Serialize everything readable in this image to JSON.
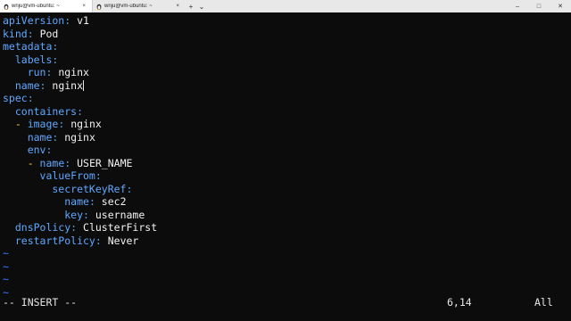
{
  "tabs": [
    {
      "label": "wriju@vm-ubuntu: ~",
      "close": "×"
    },
    {
      "label": "wriju@vm-ubuntu: ~",
      "close": "×"
    }
  ],
  "toolbar": {
    "new_tab": "+",
    "dropdown": "⌄"
  },
  "window": {
    "minimize": "–",
    "maximize": "□",
    "close": "✕"
  },
  "editor": {
    "lines": [
      [
        {
          "t": "apiVersion",
          "c": "k"
        },
        {
          "t": ": ",
          "c": "p"
        },
        {
          "t": "v1",
          "c": "v"
        }
      ],
      [
        {
          "t": "kind",
          "c": "k"
        },
        {
          "t": ": ",
          "c": "p"
        },
        {
          "t": "Pod",
          "c": "v"
        }
      ],
      [
        {
          "t": "metadata",
          "c": "k"
        },
        {
          "t": ":",
          "c": "p"
        }
      ],
      [
        {
          "t": "  labels",
          "c": "k"
        },
        {
          "t": ":",
          "c": "p"
        }
      ],
      [
        {
          "t": "    run",
          "c": "k"
        },
        {
          "t": ": ",
          "c": "p"
        },
        {
          "t": "nginx",
          "c": "v"
        }
      ],
      [
        {
          "t": "  name",
          "c": "k"
        },
        {
          "t": ": ",
          "c": "p"
        },
        {
          "t": "nginx",
          "c": "v"
        }
      ],
      [
        {
          "t": "spec",
          "c": "k"
        },
        {
          "t": ":",
          "c": "p"
        }
      ],
      [
        {
          "t": "  containers",
          "c": "k"
        },
        {
          "t": ":",
          "c": "p"
        }
      ],
      [
        {
          "t": "  - ",
          "c": "d"
        },
        {
          "t": "image",
          "c": "k"
        },
        {
          "t": ": ",
          "c": "p"
        },
        {
          "t": "nginx",
          "c": "v"
        }
      ],
      [
        {
          "t": "    name",
          "c": "k"
        },
        {
          "t": ": ",
          "c": "p"
        },
        {
          "t": "nginx",
          "c": "v"
        }
      ],
      [
        {
          "t": "    env",
          "c": "k"
        },
        {
          "t": ":",
          "c": "p"
        }
      ],
      [
        {
          "t": "    - ",
          "c": "d"
        },
        {
          "t": "name",
          "c": "k"
        },
        {
          "t": ": ",
          "c": "p"
        },
        {
          "t": "USER_NAME",
          "c": "v"
        }
      ],
      [
        {
          "t": "      valueFrom",
          "c": "k"
        },
        {
          "t": ":",
          "c": "p"
        }
      ],
      [
        {
          "t": "        secretKeyRef",
          "c": "k"
        },
        {
          "t": ":",
          "c": "p"
        }
      ],
      [
        {
          "t": "          name",
          "c": "k"
        },
        {
          "t": ": ",
          "c": "p"
        },
        {
          "t": "sec2",
          "c": "v"
        }
      ],
      [
        {
          "t": "          key",
          "c": "k"
        },
        {
          "t": ": ",
          "c": "p"
        },
        {
          "t": "username",
          "c": "v"
        }
      ],
      [
        {
          "t": "  dnsPolicy",
          "c": "k"
        },
        {
          "t": ": ",
          "c": "p"
        },
        {
          "t": "ClusterFirst",
          "c": "v"
        }
      ],
      [
        {
          "t": "  restartPolicy",
          "c": "k"
        },
        {
          "t": ": ",
          "c": "p"
        },
        {
          "t": "Never",
          "c": "v"
        }
      ],
      [
        {
          "t": "~",
          "c": "tilde"
        }
      ],
      [
        {
          "t": "~",
          "c": "tilde"
        }
      ],
      [
        {
          "t": "~",
          "c": "tilde"
        }
      ],
      [
        {
          "t": "~",
          "c": "tilde"
        }
      ]
    ],
    "cursor_line": 5
  },
  "status": {
    "mode": "-- INSERT --",
    "position": "6,14",
    "scroll": "All"
  }
}
